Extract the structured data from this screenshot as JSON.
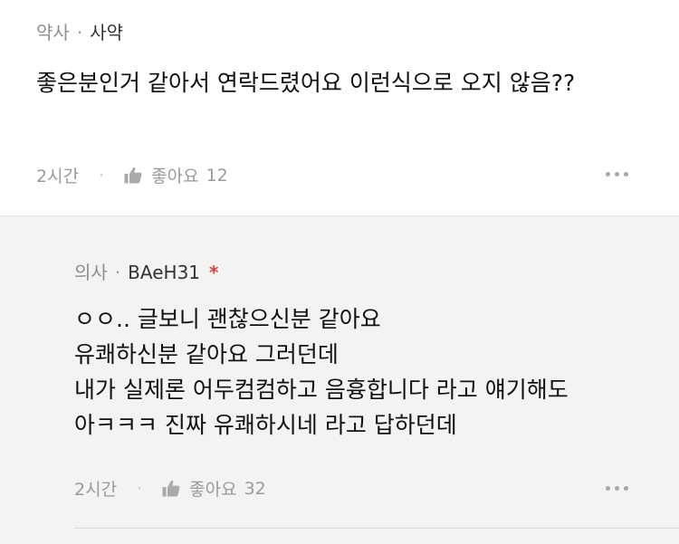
{
  "comment": {
    "author_type": "약사",
    "separator": "·",
    "author_name": "사약",
    "text": "좋은분인거 같아서 연락드렸어요  이런식으로 오지 않음??",
    "time": "2시간",
    "like_label": "좋아요",
    "like_count": "12"
  },
  "reply": {
    "author_type": "의사",
    "separator": "·",
    "author_name": "BAeH31",
    "author_mark": "*",
    "lines": [
      "ㅇㅇ.. 글보니 괜찮으신분 같아요",
      "유쾌하신분 같아요 그러던데",
      "내가 실제론 어두컴컴하고 음흉합니다 라고 얘기해도",
      "아ㅋㅋㅋ 진짜 유쾌하시네 라고 답하던데"
    ],
    "time": "2시간",
    "like_label": "좋아요",
    "like_count": "32"
  },
  "icons": {
    "like": "thumbs-up-icon",
    "more": "more-horizontal-icon"
  },
  "colors": {
    "meta_gray": "#8e8e8e",
    "reply_background": "#f3f3f3",
    "author_mark_red": "#e0412f"
  }
}
